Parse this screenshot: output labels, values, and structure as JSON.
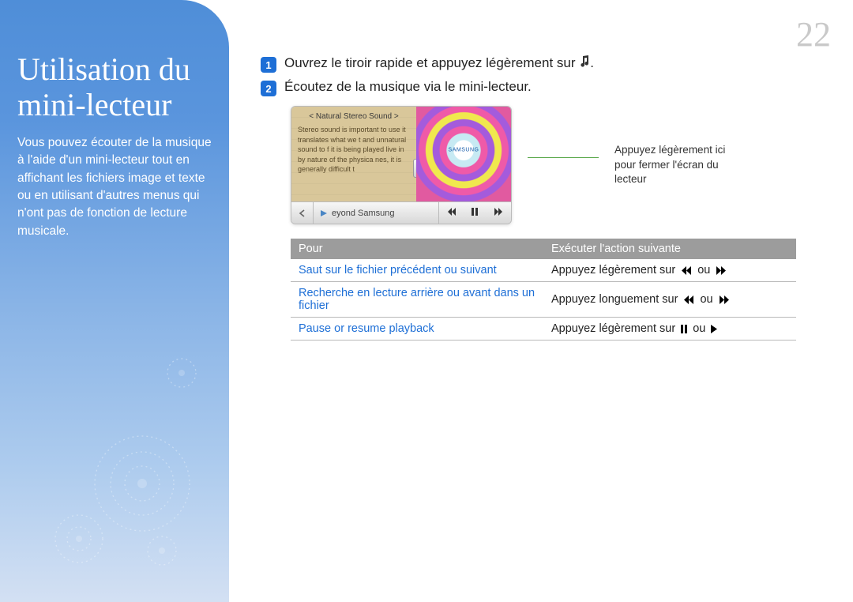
{
  "page_number": "22",
  "sidebar": {
    "title_line1": "Utilisation du",
    "title_line2": "mini-lecteur",
    "description": "Vous pouvez écouter de la musique à l'aide d'un mini-lecteur tout en affichant les fichiers image et texte ou en utilisant d'autres menus qui n'ont pas de fonction de lecture musicale."
  },
  "steps": {
    "s1_badge": "1",
    "s1_text": "Ouvrez le tiroir rapide et appuyez légèrement sur ",
    "s2_badge": "2",
    "s2_text": "Écoutez de la musique via le mini-lecteur."
  },
  "mini_player": {
    "pane_title": "< Natural Stereo Sound >",
    "pane_body": "Stereo sound is important to use it translates what we t and unnatural sound to f it is being played live in by nature of the physica nes, it is generally difficult t",
    "art_brand": "SAMSUNG",
    "track_label": "eyond Samsung"
  },
  "callout": "Appuyez légèrement ici pour fermer l'écran du lecteur",
  "table": {
    "header_left": "Pour",
    "header_right": "Exécuter l'action suivante",
    "rows": [
      {
        "left": "Saut sur le fichier précédent ou suivant",
        "right_pre": "Appuyez légèrement sur ",
        "right_mid": " ou ",
        "icons": "skip"
      },
      {
        "left": "Recherche en lecture arrière ou avant dans un fichier",
        "right_pre": "Appuyez longuement sur ",
        "right_mid": " ou ",
        "icons": "skip"
      },
      {
        "left": "Pause or resume playback",
        "right_pre": "Appuyez légèrement sur ",
        "right_mid": " ou ",
        "icons": "playpause"
      }
    ]
  }
}
